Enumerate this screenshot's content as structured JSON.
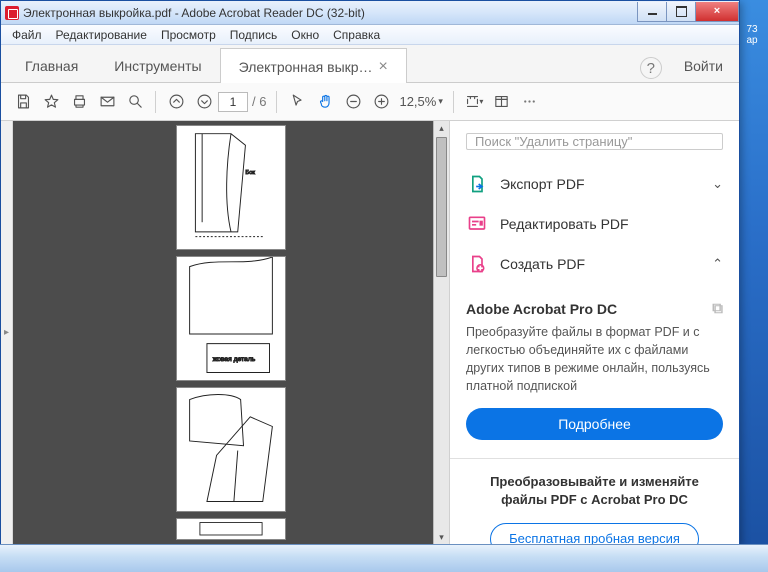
{
  "window": {
    "title": "Электронная выкройка.pdf - Adobe Acrobat Reader DC (32-bit)"
  },
  "menu": [
    "Файл",
    "Редактирование",
    "Просмотр",
    "Подпись",
    "Окно",
    "Справка"
  ],
  "tabs": {
    "home": "Главная",
    "tools": "Инструменты",
    "doc": "Электронная выкр…",
    "login": "Войти"
  },
  "toolbar": {
    "page_current": "1",
    "page_total": "/  6",
    "zoom": "12,5%"
  },
  "right": {
    "search_placeholder": "Поиск \"Удалить страницу\"",
    "export": "Экспорт PDF",
    "edit": "Редактировать PDF",
    "create": "Создать PDF",
    "promo_head": "Adobe Acrobat Pro DC",
    "promo_text": "Преобразуйте файлы в формат PDF и с легкостью объединяйте их с файлами других типов в режиме онлайн, пользуясь платной подпиской",
    "more_btn": "Подробнее",
    "promo2_head": "Преобразовывайте и изменяйте файлы PDF с Acrobat Pro DC",
    "trial_btn": "Бесплатная пробная версия"
  },
  "desktop": {
    "icon1": "73",
    "icon2": "ар"
  }
}
